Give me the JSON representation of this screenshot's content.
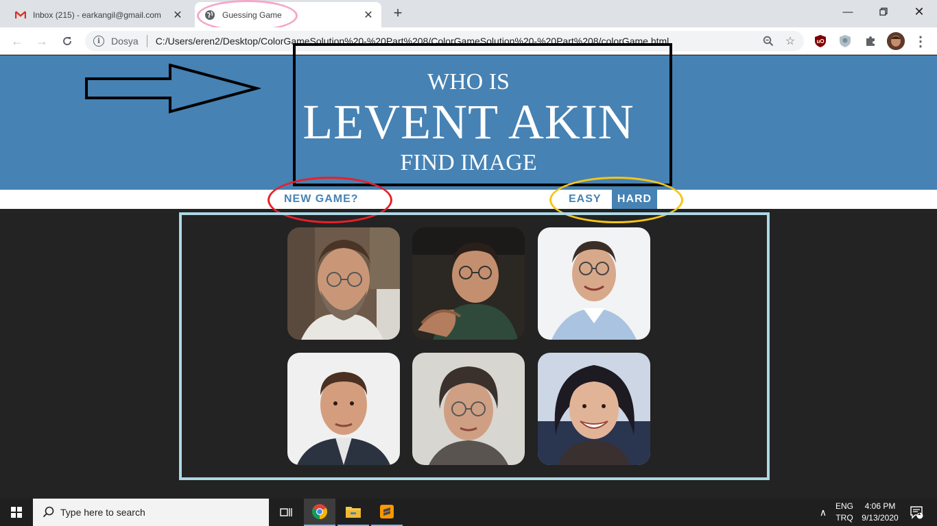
{
  "browser": {
    "tabs": [
      {
        "title": "Inbox (215) - earkangil@gmail.com",
        "icon": "gmail-icon",
        "active": false
      },
      {
        "title": "Guessing Game",
        "icon": "globe-icon",
        "active": true
      }
    ],
    "address": {
      "scheme_label": "Dosya",
      "url": "C:/Users/eren2/Desktop/ColorGameSolution%20-%20Part%208/ColorGameSolution%20-%20Part%208/colorGame.html"
    }
  },
  "page": {
    "header": {
      "line1": "WHO IS",
      "line2": "LEVENT AKIN",
      "line3": "FIND IMAGE"
    },
    "controls": {
      "new_game": "NEW GAME?",
      "easy": "EASY",
      "hard": "HARD",
      "selected_mode": "hard"
    },
    "colors": {
      "header_bg": "#4682b4",
      "body_bg": "#232323",
      "container_border": "#add8e6"
    },
    "annotations": {
      "box_color": "#000000",
      "ellipse_tab": "#f4a7c8",
      "ellipse_new_game": "#e8202a",
      "ellipse_modes": "#f5c518"
    },
    "photos": [
      {
        "name": "bearded man with glasses"
      },
      {
        "name": "older man with glasses"
      },
      {
        "name": "smiling man with glasses"
      },
      {
        "name": "man in suit"
      },
      {
        "name": "woman with short hair and glasses"
      },
      {
        "name": "smiling woman"
      }
    ]
  },
  "taskbar": {
    "search_placeholder": "Type here to search",
    "language": "ENG",
    "layout": "TRQ",
    "time": "4:06 PM",
    "date": "9/13/2020",
    "notifications": "1"
  }
}
